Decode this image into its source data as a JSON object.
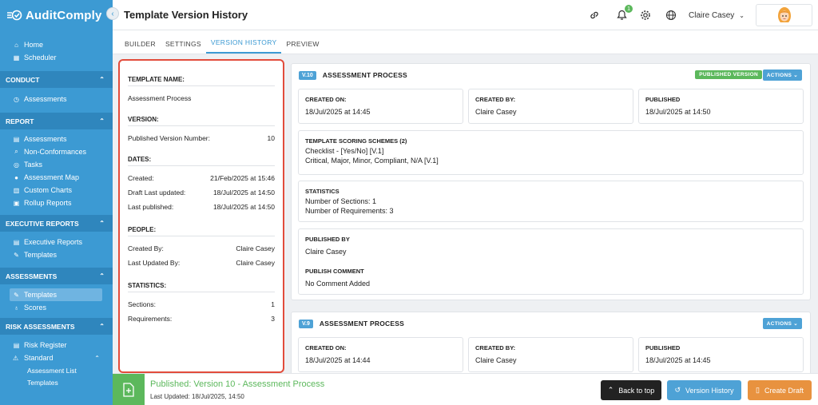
{
  "app": {
    "name": "AuditComply"
  },
  "sidebar": {
    "top_items": [
      {
        "label": "Home",
        "icon": "home-icon"
      },
      {
        "label": "Scheduler",
        "icon": "calendar-icon"
      }
    ],
    "sections": {
      "conduct": {
        "title": "CONDUCT",
        "items": [
          {
            "label": "Assessments",
            "icon": "clock-icon"
          }
        ]
      },
      "report": {
        "title": "REPORT",
        "items": [
          {
            "label": "Assessments",
            "icon": "list-icon"
          },
          {
            "label": "Non-Conformances",
            "icon": "search-icon"
          },
          {
            "label": "Tasks",
            "icon": "target-icon"
          },
          {
            "label": "Assessment Map",
            "icon": "map-pin-icon"
          },
          {
            "label": "Custom Charts",
            "icon": "chart-icon"
          },
          {
            "label": "Rollup Reports",
            "icon": "image-icon"
          }
        ]
      },
      "executive": {
        "title": "EXECUTIVE REPORTS",
        "items": [
          {
            "label": "Executive Reports",
            "icon": "list-icon"
          },
          {
            "label": "Templates",
            "icon": "edit-icon"
          }
        ]
      },
      "assessments": {
        "title": "ASSESSMENTS",
        "items": [
          {
            "label": "Templates",
            "icon": "edit-icon"
          },
          {
            "label": "Scores",
            "icon": "ribbon-icon"
          }
        ]
      },
      "risk": {
        "title": "RISK ASSESSMENTS",
        "items": [
          {
            "label": "Risk Register",
            "icon": "list-icon"
          }
        ],
        "group": {
          "label": "Standard",
          "icon": "warning-icon",
          "subitems": [
            "Assessment List",
            "Templates"
          ]
        }
      }
    }
  },
  "header": {
    "title": "Template Version History",
    "user_name": "Claire Casey",
    "notification_count": "1"
  },
  "tabs": [
    {
      "label": "BUILDER"
    },
    {
      "label": "SETTINGS"
    },
    {
      "label": "VERSION HISTORY"
    },
    {
      "label": "PREVIEW"
    }
  ],
  "info_panel": {
    "template_name_heading": "TEMPLATE NAME:",
    "template_name": "Assessment Process",
    "version_heading": "VERSION:",
    "version_label": "Published Version Number:",
    "version_value": "10",
    "dates_heading": "DATES:",
    "created_label": "Created:",
    "created_value": "21/Feb/2025 at 15:46",
    "draft_label": "Draft Last updated:",
    "draft_value": "18/Jul/2025 at 14:50",
    "published_label": "Last published:",
    "published_value": "18/Jul/2025 at 14:50",
    "people_heading": "PEOPLE:",
    "created_by_label": "Created By:",
    "created_by_value": "Claire Casey",
    "updated_by_label": "Last Updated By:",
    "updated_by_value": "Claire Casey",
    "statistics_heading": "STATISTICS:",
    "sections_label": "Sections:",
    "sections_value": "1",
    "requirements_label": "Requirements:",
    "requirements_value": "3"
  },
  "versions": [
    {
      "tag": "V.10",
      "name": "ASSESSMENT PROCESS",
      "published_badge": "PUBLISHED VERSION",
      "actions_label": "ACTIONS",
      "created_on_label": "CREATED ON:",
      "created_on": "18/Jul/2025 at 14:45",
      "created_by_label": "CREATED BY:",
      "created_by": "Claire Casey",
      "published_label": "PUBLISHED",
      "published": "18/Jul/2025 at 14:50",
      "scoring_label": "TEMPLATE SCORING SCHEMES (2)",
      "scoring_1": "Checklist - [Yes/No] [V.1]",
      "scoring_2": "Critical, Major, Minor, Compliant, N/A [V.1]",
      "statistics_label": "STATISTICS",
      "stat_sections": "Number of Sections: 1",
      "stat_requirements": "Number of Requirements: 3",
      "published_by_label": "PUBLISHED BY",
      "published_by": "Claire Casey",
      "comment_label": "PUBLISH COMMENT",
      "comment": "No Comment Added"
    },
    {
      "tag": "V.9",
      "name": "ASSESSMENT PROCESS",
      "actions_label": "ACTIONS",
      "created_on_label": "CREATED ON:",
      "created_on": "18/Jul/2025 at 14:44",
      "created_by_label": "CREATED BY:",
      "created_by": "Claire Casey",
      "published_label": "PUBLISHED",
      "published": "18/Jul/2025 at 14:45"
    }
  ],
  "footer": {
    "title": "Published: Version 10 - Assessment Process",
    "subtitle": "Last Updated: 18/Jul/2025, 14:50",
    "back_to_top": "Back to top",
    "version_history": "Version History",
    "create_draft": "Create Draft"
  },
  "colors": {
    "sidebar": "#3c9ad3",
    "accent": "#3c9ad3",
    "success": "#5cb85c",
    "highlight_border": "#e24c3c",
    "create_draft": "#e8923f"
  }
}
